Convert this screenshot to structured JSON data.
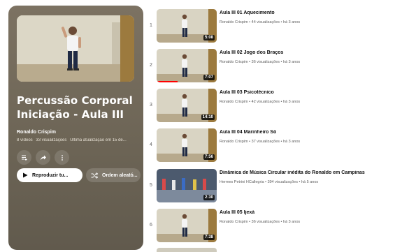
{
  "playlist": {
    "title_line1": "Percussão Corporal",
    "title_line2": "Iniciação - Aula III",
    "owner": "Ronaldo Crispim",
    "video_count": "8 vídeos",
    "views": "33 visualizações",
    "updated": "Última atualização em 15 de...",
    "play_label": "Reproduzir tu...",
    "shuffle_label": "Ordem aleató..."
  },
  "icons": {
    "save": "add-to-queue-icon",
    "share": "share-icon",
    "more": "more-vert-icon",
    "play": "play-icon",
    "shuffle": "shuffle-icon"
  },
  "colors": {
    "header_bg": "#6d6556",
    "progress": "#ff0000",
    "title_text": "#0f0f0f",
    "meta_text": "#606060"
  },
  "videos": [
    {
      "index": "1",
      "title": "Aula III 01 Aquecimento",
      "channel": "Ronaldo Crispim",
      "views": "44 visualizações",
      "age": "há 3 anos",
      "duration": "5:08",
      "progress": 0
    },
    {
      "index": "2",
      "title": "Aula III 02 Jogo dos Braços",
      "channel": "Ronaldo Crispim",
      "views": "36 visualizações",
      "age": "há 3 anos",
      "duration": "7:07",
      "progress": 0.35
    },
    {
      "index": "3",
      "title": "Aula III 03 Psicotécnico",
      "channel": "Ronaldo Crispim",
      "views": "42 visualizações",
      "age": "há 3 anos",
      "duration": "14:10",
      "progress": 0
    },
    {
      "index": "4",
      "title": "Aula III 04 Marinheiro Só",
      "channel": "Ronaldo Crispim",
      "views": "37 visualizações",
      "age": "há 3 anos",
      "duration": "7:56",
      "progress": 0
    },
    {
      "index": "5",
      "title": "Dinâmica de Música Circular inédita do Ronaldo em Campinas",
      "channel": "Hermes Petrini HCallegria",
      "views": "394 visualizações",
      "age": "há 5 anos",
      "duration": "2:30",
      "progress": 0
    },
    {
      "index": "6",
      "title": "Aula III 05 Ijexá",
      "channel": "Ronaldo Crispim",
      "views": "36 visualizações",
      "age": "há 3 anos",
      "duration": "7:38",
      "progress": 0
    }
  ]
}
